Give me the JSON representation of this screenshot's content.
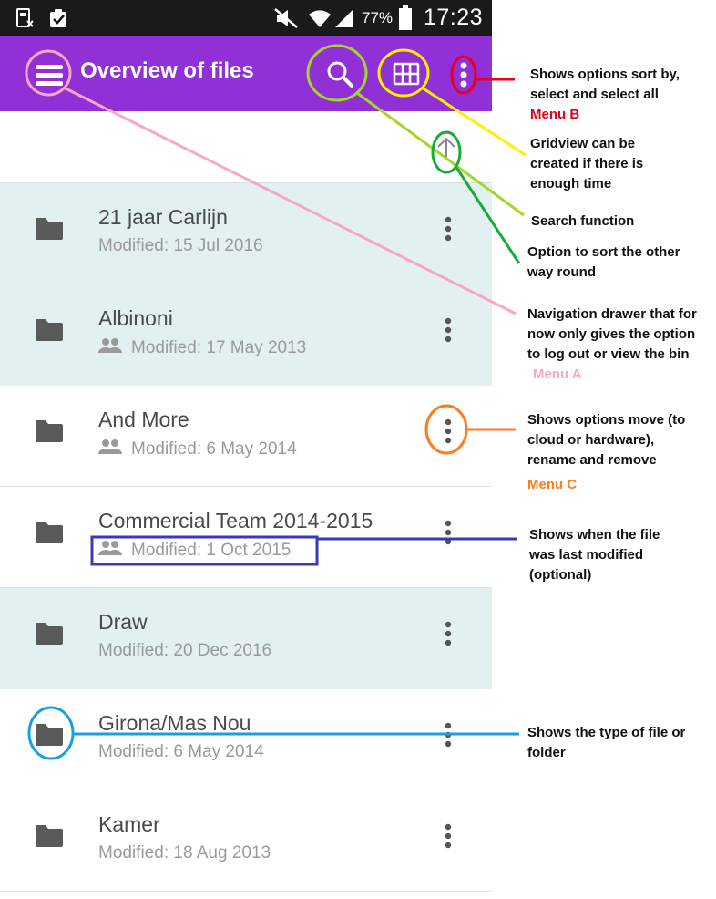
{
  "status_bar": {
    "battery_percent": "77%",
    "time": "17:23"
  },
  "app_bar": {
    "title": "Overview of files",
    "color": "#9030d6",
    "icons": [
      "menu-icon",
      "search-icon",
      "grid-view-icon",
      "more-vert-icon"
    ]
  },
  "files": [
    {
      "name": "21 jaar Carlijn",
      "modified": "Modified: 15 Jul 2016",
      "shared": false,
      "highlighted": true
    },
    {
      "name": "Albinoni",
      "modified": "Modified: 17 May 2013",
      "shared": true,
      "highlighted": true
    },
    {
      "name": "And More",
      "modified": "Modified: 6 May 2014",
      "shared": true,
      "highlighted": false
    },
    {
      "name": "Commercial Team 2014-2015",
      "modified": "Modified: 1 Oct 2015",
      "shared": true,
      "highlighted": false
    },
    {
      "name": "Draw",
      "modified": "Modified: 20 Dec 2016",
      "shared": false,
      "highlighted": true
    },
    {
      "name": "Girona/Mas Nou",
      "modified": "Modified: 6 May 2014",
      "shared": false,
      "highlighted": false
    },
    {
      "name": "Kamer",
      "modified": "Modified: 18 Aug 2013",
      "shared": false,
      "highlighted": false
    }
  ],
  "annotations": {
    "menu_b": {
      "text": "Shows options sort by, select and select all",
      "tag": "Menu B",
      "color": "#e8001c"
    },
    "gridview": {
      "text": "Gridview can be created if there is enough time",
      "color": "#ffee00"
    },
    "search": {
      "text": "Search function",
      "color": "#a4d62a"
    },
    "sort": {
      "text": "Option to sort the other way round",
      "color": "#1aaa3a"
    },
    "drawer": {
      "text": "Navigation drawer that for now only gives the option to log out or view the bin",
      "tag": "Menu A",
      "color": "#f7a6c8"
    },
    "menu_c": {
      "text": "Shows options move (to cloud or hardware), rename and remove",
      "tag": "Menu C",
      "color": "#ff7b1c"
    },
    "modified": {
      "text": "Shows when the file was last modified (optional)",
      "color": "#3a3ab8"
    },
    "type": {
      "text": "Shows the type of file or folder",
      "color": "#1a9ee0"
    }
  }
}
